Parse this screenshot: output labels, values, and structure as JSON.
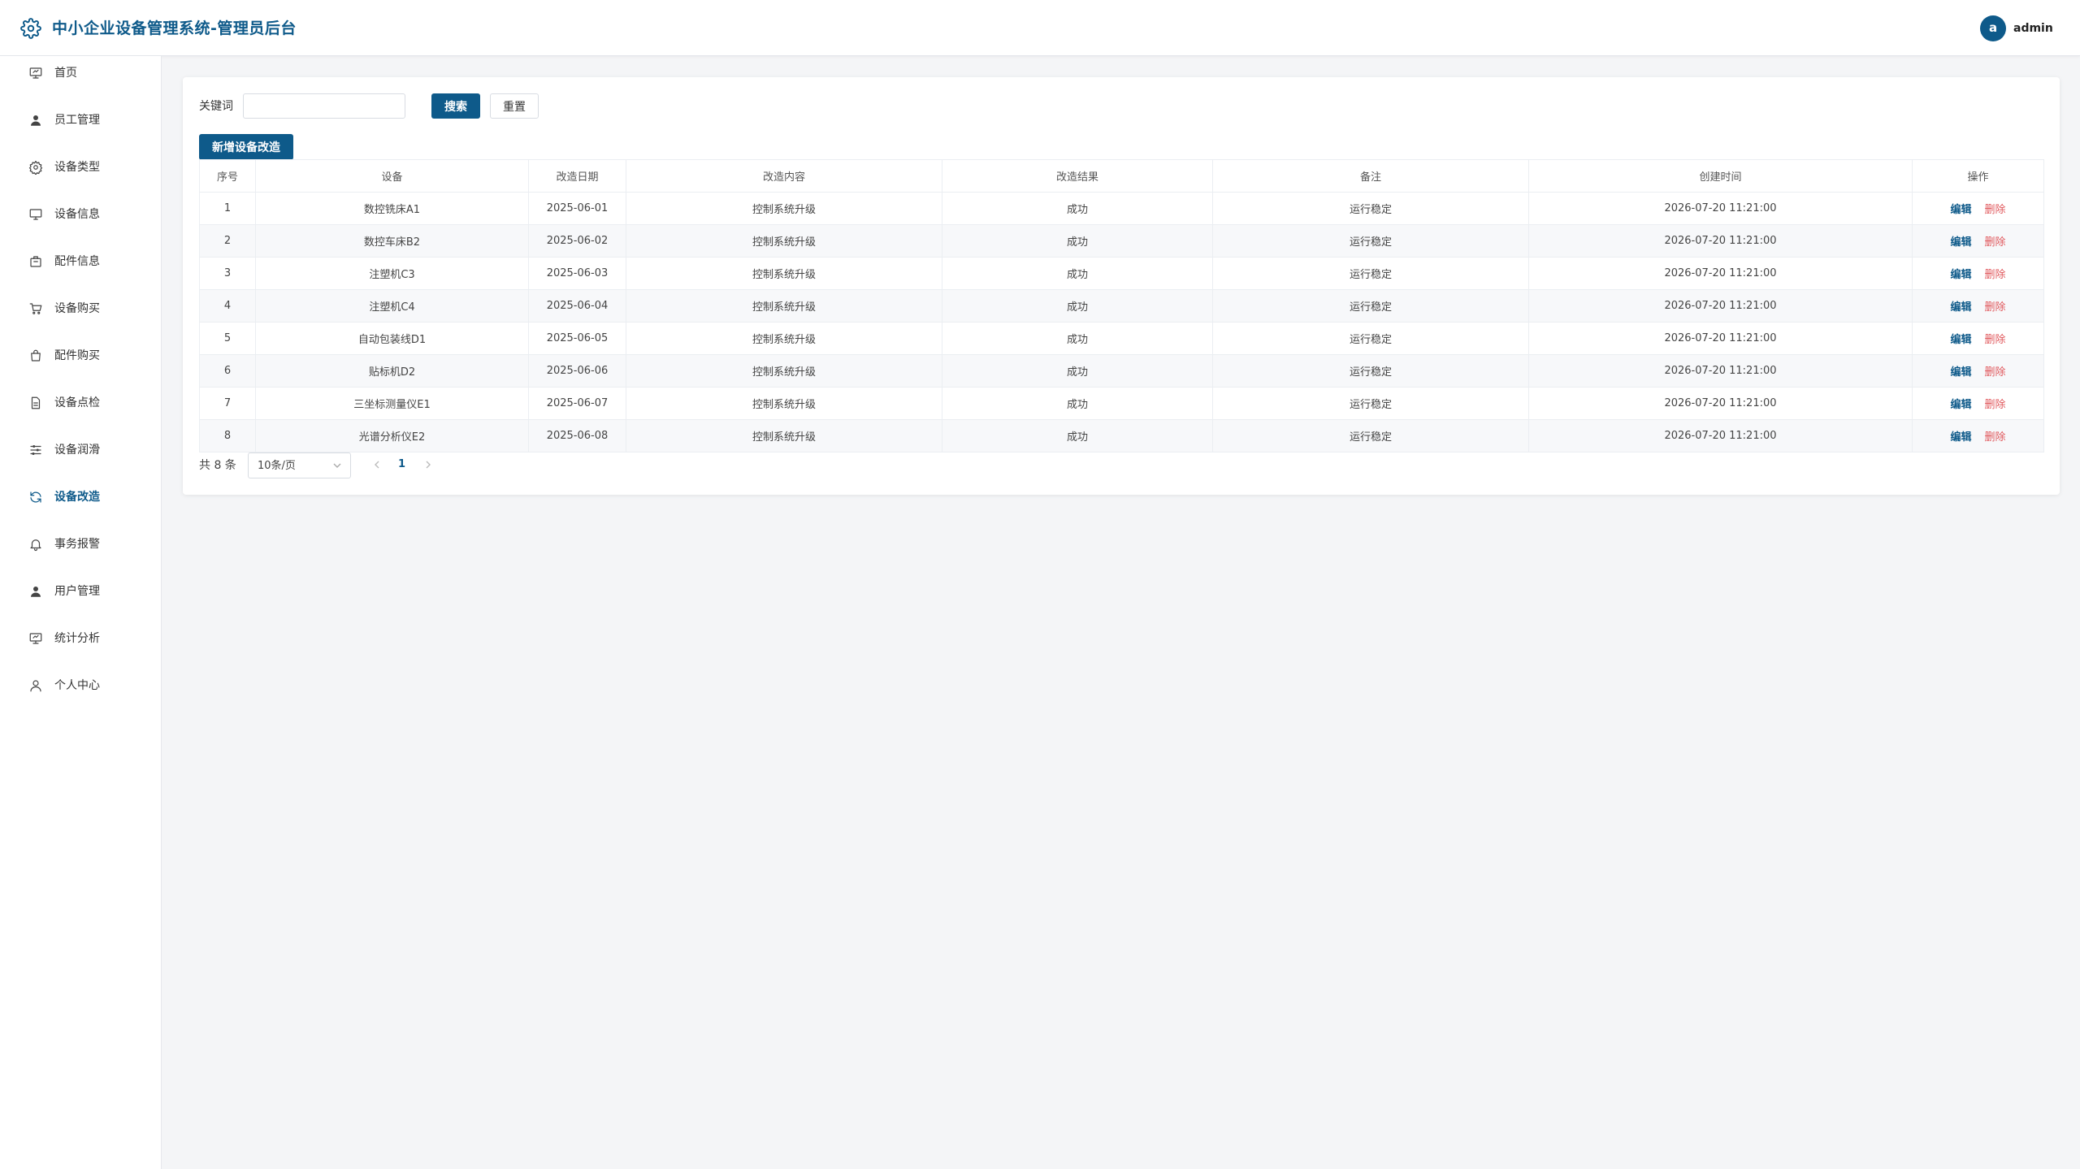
{
  "header": {
    "logo_icon": "gear-icon",
    "title": "中小企业设备管理系统-管理员后台",
    "avatar_letter": "a",
    "user_name": "admin",
    "brand_color": "#0e5a8a"
  },
  "sidebar": {
    "items": [
      {
        "label": "首页",
        "icon": "presentation-icon",
        "active": false
      },
      {
        "label": "员工管理",
        "icon": "user-icon",
        "active": false
      },
      {
        "label": "设备类型",
        "icon": "settings-icon",
        "active": false
      },
      {
        "label": "设备信息",
        "icon": "monitor-icon",
        "active": false
      },
      {
        "label": "配件信息",
        "icon": "box-icon",
        "active": false
      },
      {
        "label": "设备购买",
        "icon": "cart-icon",
        "active": false
      },
      {
        "label": "配件购买",
        "icon": "bag-icon",
        "active": false
      },
      {
        "label": "设备点检",
        "icon": "document-icon",
        "active": false
      },
      {
        "label": "设备润滑",
        "icon": "sliders-icon",
        "active": false
      },
      {
        "label": "设备改造",
        "icon": "refresh-icon",
        "active": true
      },
      {
        "label": "事务报警",
        "icon": "bell-icon",
        "active": false
      },
      {
        "label": "用户管理",
        "icon": "user-icon",
        "active": false
      },
      {
        "label": "统计分析",
        "icon": "presentation-icon",
        "active": false
      },
      {
        "label": "个人中心",
        "icon": "user-outline-icon",
        "active": false
      }
    ]
  },
  "search": {
    "label": "关键词",
    "value": "",
    "placeholder": "",
    "search_button": "搜索",
    "reset_button": "重置"
  },
  "add_button": "新增设备改造",
  "table": {
    "columns": [
      "序号",
      "设备",
      "改造日期",
      "改造内容",
      "改造结果",
      "备注",
      "创建时间",
      "操作"
    ],
    "rows": [
      {
        "no": "1",
        "device": "数控铣床A1",
        "date": "2025-06-01",
        "content": "控制系统升级",
        "result": "成功",
        "remark": "运行稳定",
        "created": "2026-07-20 11:21:00"
      },
      {
        "no": "2",
        "device": "数控车床B2",
        "date": "2025-06-02",
        "content": "控制系统升级",
        "result": "成功",
        "remark": "运行稳定",
        "created": "2026-07-20 11:21:00"
      },
      {
        "no": "3",
        "device": "注塑机C3",
        "date": "2025-06-03",
        "content": "控制系统升级",
        "result": "成功",
        "remark": "运行稳定",
        "created": "2026-07-20 11:21:00"
      },
      {
        "no": "4",
        "device": "注塑机C4",
        "date": "2025-06-04",
        "content": "控制系统升级",
        "result": "成功",
        "remark": "运行稳定",
        "created": "2026-07-20 11:21:00"
      },
      {
        "no": "5",
        "device": "自动包装线D1",
        "date": "2025-06-05",
        "content": "控制系统升级",
        "result": "成功",
        "remark": "运行稳定",
        "created": "2026-07-20 11:21:00"
      },
      {
        "no": "6",
        "device": "贴标机D2",
        "date": "2025-06-06",
        "content": "控制系统升级",
        "result": "成功",
        "remark": "运行稳定",
        "created": "2026-07-20 11:21:00"
      },
      {
        "no": "7",
        "device": "三坐标测量仪E1",
        "date": "2025-06-07",
        "content": "控制系统升级",
        "result": "成功",
        "remark": "运行稳定",
        "created": "2026-07-20 11:21:00"
      },
      {
        "no": "8",
        "device": "光谱分析仪E2",
        "date": "2025-06-08",
        "content": "控制系统升级",
        "result": "成功",
        "remark": "运行稳定",
        "created": "2026-07-20 11:21:00"
      }
    ],
    "edit_label": "编辑",
    "delete_label": "删除",
    "delete_color": "#e0575b"
  },
  "pagination": {
    "total": "共 8 条",
    "page_size": "10条/页",
    "current_page": "1"
  }
}
